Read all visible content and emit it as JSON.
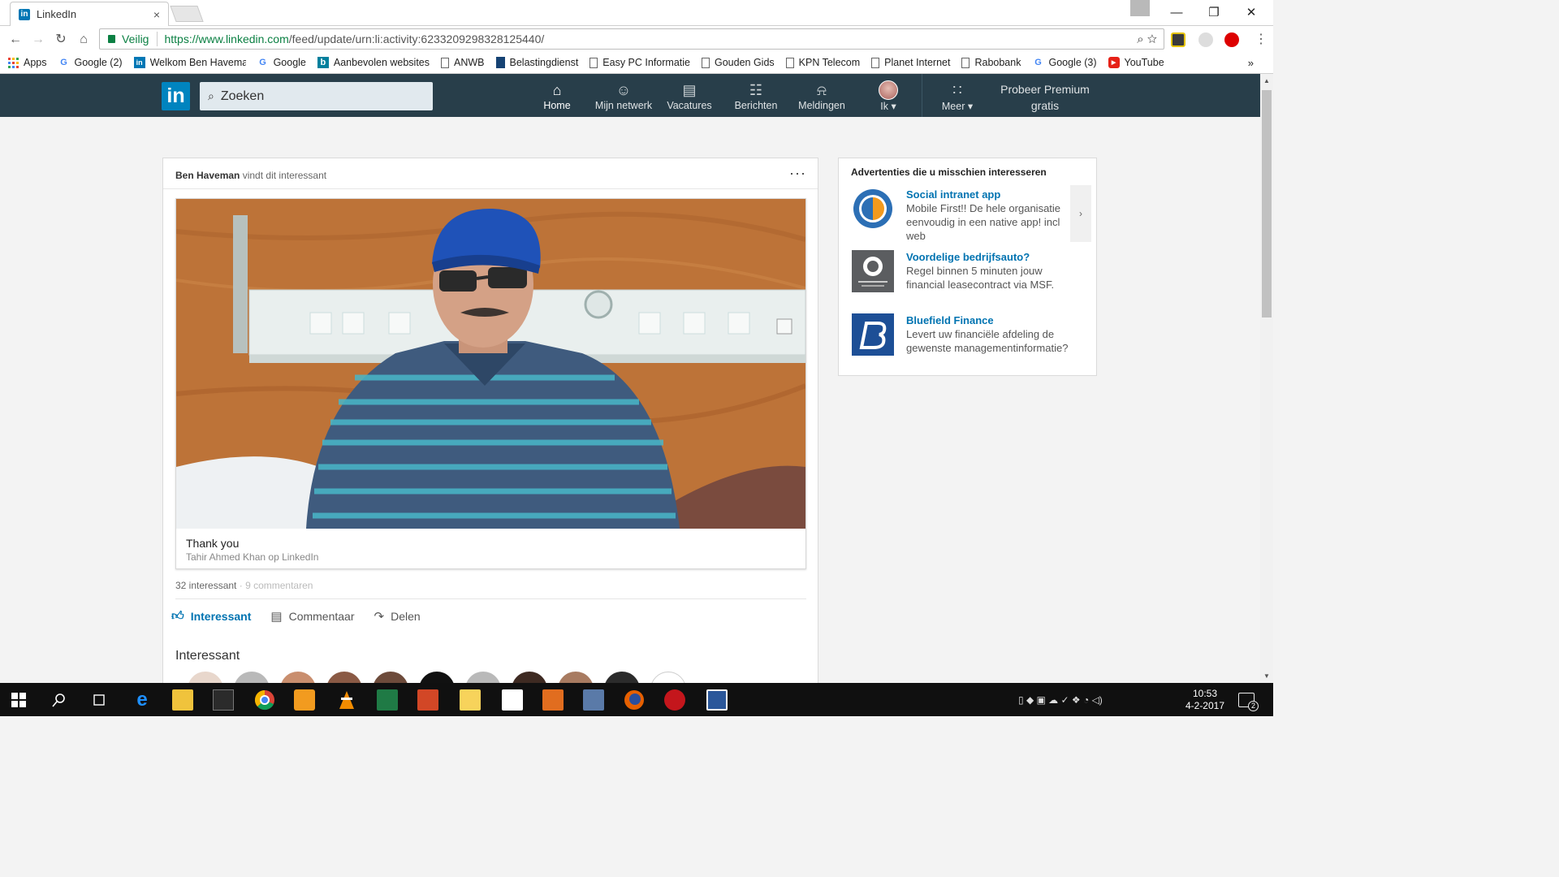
{
  "browser": {
    "tab_title": "LinkedIn",
    "tab_close": "×",
    "secure_label": "Veilig",
    "url_host": "https://www.linkedin.com",
    "url_path": "/feed/update/urn:li:activity:6233209298328125440/",
    "window_controls": {
      "minimize": "—",
      "restore": "❐",
      "close": "✕"
    },
    "bookmarks": [
      {
        "label": "Apps",
        "icon": "apps-grid-icon"
      },
      {
        "label": "Google (2)",
        "icon": "google-icon"
      },
      {
        "label": "Welkom Ben Haveman",
        "icon": "linkedin-icon"
      },
      {
        "label": "Google",
        "icon": "google-icon"
      },
      {
        "label": "Aanbevolen websites",
        "icon": "bing-icon"
      },
      {
        "label": "ANWB",
        "icon": "page-icon"
      },
      {
        "label": "Belastingdienst",
        "icon": "belastingdienst-icon"
      },
      {
        "label": "Easy PC Informatie",
        "icon": "page-icon"
      },
      {
        "label": "Gouden Gids",
        "icon": "page-icon"
      },
      {
        "label": "KPN Telecom",
        "icon": "page-icon"
      },
      {
        "label": "Planet Internet",
        "icon": "page-icon"
      },
      {
        "label": "Rabobank",
        "icon": "page-icon"
      },
      {
        "label": "Google (3)",
        "icon": "google-icon"
      },
      {
        "label": "YouTube",
        "icon": "youtube-icon"
      }
    ],
    "bookmarks_more": "»"
  },
  "linkedin_nav": {
    "logo": "in",
    "search_placeholder": "Zoeken",
    "items": [
      {
        "label": "Home",
        "icon": "home-icon",
        "active": true
      },
      {
        "label": "Mijn netwerk",
        "icon": "network-icon"
      },
      {
        "label": "Vacatures",
        "icon": "briefcase-icon"
      },
      {
        "label": "Berichten",
        "icon": "messages-icon"
      },
      {
        "label": "Meldingen",
        "icon": "bell-icon"
      },
      {
        "label": "Ik ▾",
        "icon": "avatar"
      },
      {
        "label": "Meer ▾",
        "icon": "grid-icon"
      }
    ],
    "premium": "Probeer Premium gratis"
  },
  "post": {
    "actor": "Ben Haveman",
    "actor_action": " vindt dit interessant",
    "menu": "···",
    "share_title": "Thank you",
    "share_subtitle": "Tahir Ahmed Khan op LinkedIn",
    "likes": "32 interessant",
    "separator": " · ",
    "comments": "9 commentaren",
    "actions": [
      {
        "label": "Interessant",
        "icon": "thumbs-up-icon",
        "active": true
      },
      {
        "label": "Commentaar",
        "icon": "comment-icon"
      },
      {
        "label": "Delen",
        "icon": "share-arrow-icon"
      }
    ],
    "interested_heading": "Interessant"
  },
  "ads": {
    "title": "Advertenties die u misschien interesseren",
    "next": "›",
    "items": [
      {
        "headline": "Social intranet app",
        "body": "Mobile First!! De hele organisatie eenvoudig in een native app! incl web"
      },
      {
        "headline": "Voordelige bedrijfsauto?",
        "body": "Regel binnen 5 minuten jouw financial leasecontract via MSF."
      },
      {
        "headline": "Bluefield Finance",
        "body": "Levert uw financiële afdeling de gewenste managementinformatie?"
      }
    ]
  },
  "taskbar": {
    "time": "10:53",
    "date": "4-2-2017",
    "notifications": "2"
  },
  "colors": {
    "linkedin_nav": "#283e4a",
    "linkedin_blue": "#0073b1",
    "secure_green": "#0b8043"
  }
}
